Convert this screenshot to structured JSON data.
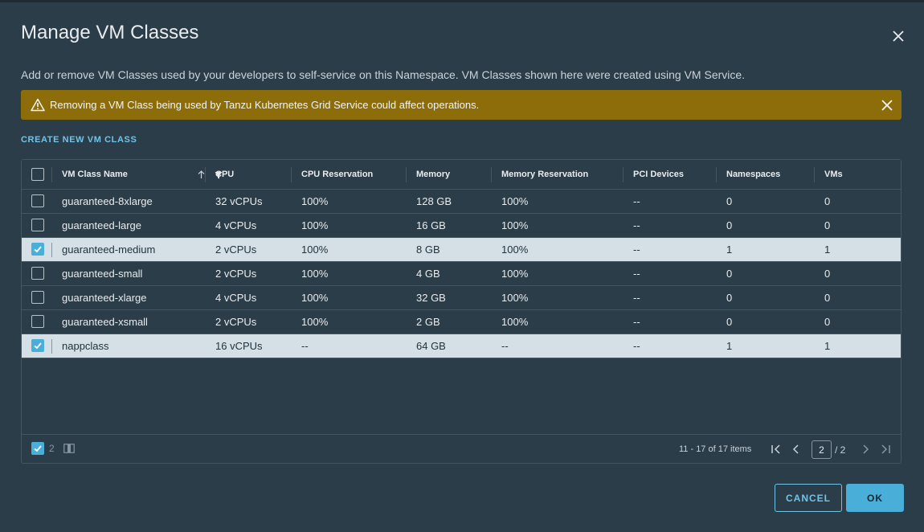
{
  "dialog": {
    "title": "Manage VM Classes",
    "description": "Add or remove VM Classes used by your developers to self-service on this Namespace. VM Classes shown here were created using VM Service.",
    "alert": "Removing a VM Class being used by Tanzu Kubernetes Grid Service could affect operations.",
    "create_link": "CREATE NEW VM CLASS",
    "cancel_label": "CANCEL",
    "ok_label": "OK"
  },
  "grid": {
    "columns": [
      "VM Class Name",
      "CPU",
      "CPU Reservation",
      "Memory",
      "Memory Reservation",
      "PCI Devices",
      "Namespaces",
      "VMs"
    ],
    "rows": [
      {
        "name": "guaranteed-8xlarge",
        "cpu": "32 vCPUs",
        "cpu_res": "100%",
        "memory": "128 GB",
        "mem_res": "100%",
        "pci": "--",
        "namespaces": "0",
        "vms": "0",
        "selected": false
      },
      {
        "name": "guaranteed-large",
        "cpu": "4 vCPUs",
        "cpu_res": "100%",
        "memory": "16 GB",
        "mem_res": "100%",
        "pci": "--",
        "namespaces": "0",
        "vms": "0",
        "selected": false
      },
      {
        "name": "guaranteed-medium",
        "cpu": "2 vCPUs",
        "cpu_res": "100%",
        "memory": "8 GB",
        "mem_res": "100%",
        "pci": "--",
        "namespaces": "1",
        "vms": "1",
        "selected": true
      },
      {
        "name": "guaranteed-small",
        "cpu": "2 vCPUs",
        "cpu_res": "100%",
        "memory": "4 GB",
        "mem_res": "100%",
        "pci": "--",
        "namespaces": "0",
        "vms": "0",
        "selected": false
      },
      {
        "name": "guaranteed-xlarge",
        "cpu": "4 vCPUs",
        "cpu_res": "100%",
        "memory": "32 GB",
        "mem_res": "100%",
        "pci": "--",
        "namespaces": "0",
        "vms": "0",
        "selected": false
      },
      {
        "name": "guaranteed-xsmall",
        "cpu": "2 vCPUs",
        "cpu_res": "100%",
        "memory": "2 GB",
        "mem_res": "100%",
        "pci": "--",
        "namespaces": "0",
        "vms": "0",
        "selected": false
      },
      {
        "name": "nappclass",
        "cpu": "16 vCPUs",
        "cpu_res": "--",
        "memory": "64 GB",
        "mem_res": "--",
        "pci": "--",
        "namespaces": "1",
        "vms": "1",
        "selected": true
      }
    ],
    "footer": {
      "selected_count": "2",
      "items_label": "11 - 17 of 17 items",
      "current_page": "2",
      "total_pages": "/ 2"
    }
  },
  "colors": {
    "accent": "#49afd9",
    "alert_bg": "#8c6d09",
    "modal_bg": "#2b3d48",
    "selected_row": "#d4e0e6"
  },
  "icons": [
    "close-icon",
    "warning-icon",
    "sort-up-icon",
    "filter-icon",
    "checkbox-icon",
    "column-toggle-icon",
    "first-page-icon",
    "prev-page-icon",
    "next-page-icon",
    "last-page-icon"
  ]
}
